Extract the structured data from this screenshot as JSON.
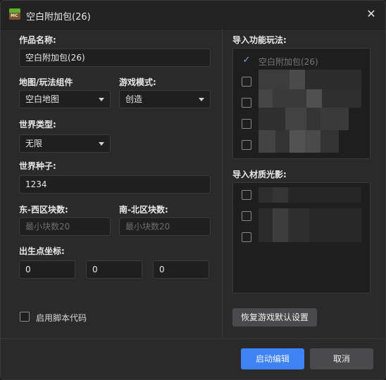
{
  "window": {
    "title": "空白附加包(26)"
  },
  "form": {
    "name_label": "作品名称:",
    "name_value": "空白附加包(26)",
    "map_label": "地图/玩法组件",
    "map_value": "空白地图",
    "mode_label": "游戏模式:",
    "mode_value": "创造",
    "world_type_label": "世界类型:",
    "world_type_value": "无限",
    "seed_label": "世界种子:",
    "seed_value": "1234",
    "ew_label": "东-西区块数:",
    "ew_placeholder": "最小块数20",
    "ns_label": "南-北区块数:",
    "ns_placeholder": "最小块数20",
    "spawn_label": "出生点坐标:",
    "spawn_x": "0",
    "spawn_y": "0",
    "spawn_z": "0",
    "script_label": "启用脚本代码"
  },
  "right": {
    "import_features_label": "导入功能玩法:",
    "features": [
      {
        "label": "空白附加包(26)",
        "checked": true
      },
      {
        "label": "",
        "checked": false
      },
      {
        "label": "",
        "checked": false
      },
      {
        "label": "",
        "checked": false
      },
      {
        "label": "",
        "checked": false
      }
    ],
    "import_textures_label": "导入材质光影:",
    "textures": [
      {
        "label": "",
        "checked": false
      },
      {
        "label": "",
        "checked": false
      },
      {
        "label": "",
        "checked": false
      }
    ],
    "restore_button": "恢复游戏默认设置"
  },
  "footer": {
    "launch_button": "启动编辑",
    "cancel_button": "取消"
  },
  "colors": {
    "accent": "#3d83f5",
    "background": "#2a2a2b"
  }
}
